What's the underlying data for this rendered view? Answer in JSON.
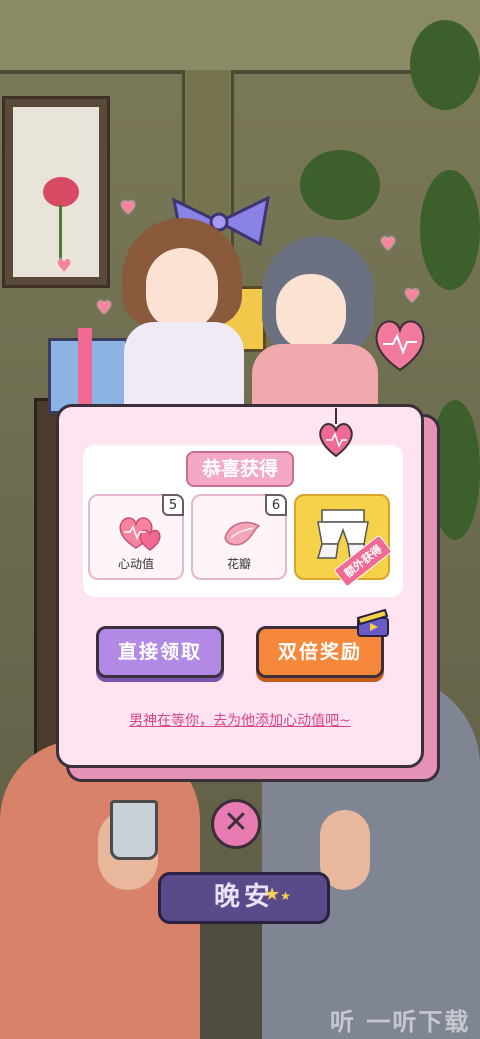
{
  "modal": {
    "title": "恭喜获得",
    "rewards": [
      {
        "name": "心动值",
        "count": "5",
        "icon": "hearts-icon"
      },
      {
        "name": "花瓣",
        "count": "6",
        "icon": "petal-icon"
      },
      {
        "name": "",
        "count": "",
        "icon": "outfit-icon",
        "tag": "额外获得"
      }
    ],
    "direct_button": "直接领取",
    "double_button": "双倍奖励",
    "hint_link": "男神在等你，去为他添加心动值吧~"
  },
  "bottom": {
    "close_label": "✕",
    "goodnight_button": "晚安"
  },
  "watermark": "听 一听下载",
  "colors": {
    "modal_bg": "#fde4f0",
    "accent_pink": "#f3a8c6",
    "direct_purple": "#b28ae6",
    "double_orange": "#f5883a",
    "night_purple": "#5a4a8a"
  }
}
